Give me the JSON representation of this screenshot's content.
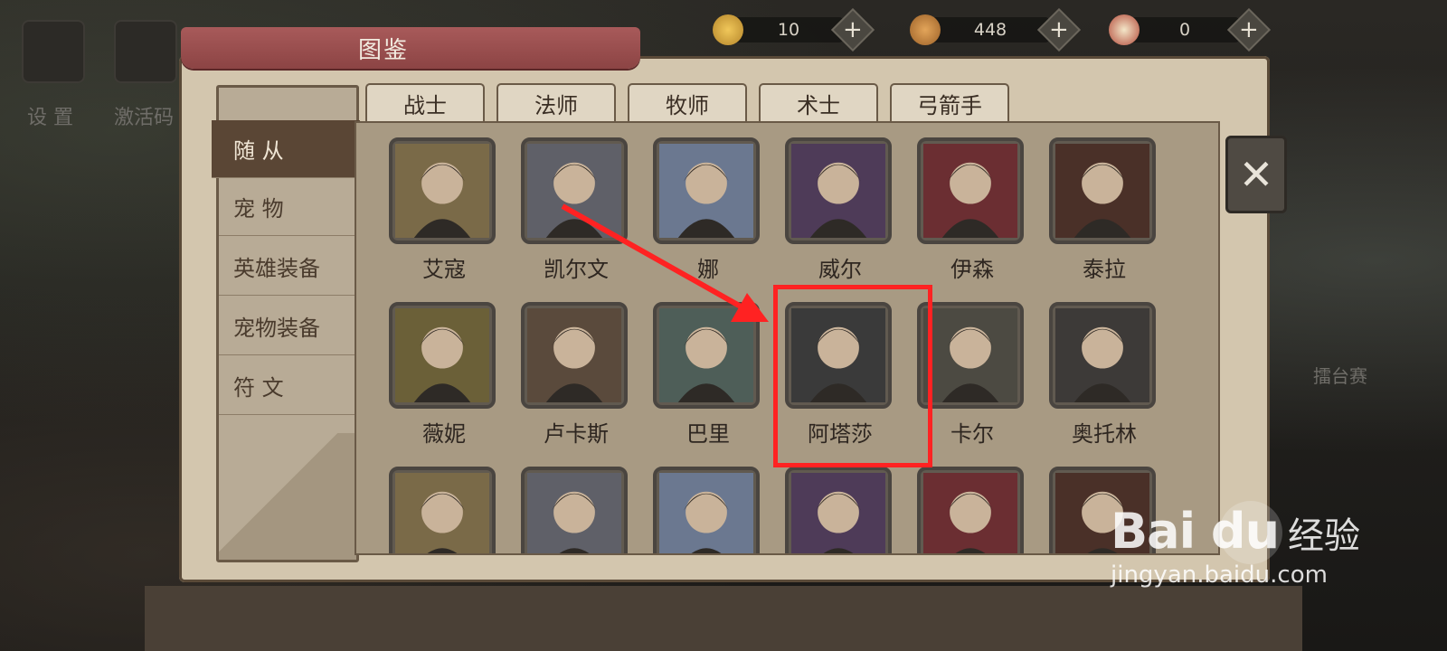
{
  "background": {
    "left_labels": [
      "设 置",
      "激活码"
    ],
    "right_label": "擂台赛"
  },
  "currencies": [
    {
      "icon": "gold-coin-icon",
      "value": "10"
    },
    {
      "icon": "coin-stack-icon",
      "value": "448"
    },
    {
      "icon": "scroll-icon",
      "value": "0"
    }
  ],
  "window": {
    "title": "图鉴"
  },
  "sidebar": {
    "items": [
      {
        "label": "随  从",
        "active": true
      },
      {
        "label": "宠  物",
        "active": false
      },
      {
        "label": "英雄装备",
        "active": false
      },
      {
        "label": "宠物装备",
        "active": false
      },
      {
        "label": "符  文",
        "active": false
      }
    ]
  },
  "tabs": [
    "战士",
    "法师",
    "牧师",
    "术士",
    "弓箭手"
  ],
  "heroes": {
    "row1": [
      "艾寇",
      "凯尔文",
      "娜",
      "威尔",
      "伊森",
      "泰拉"
    ],
    "row2": [
      "薇妮",
      "卢卡斯",
      "巴里",
      "阿塔莎",
      "卡尔",
      "奥托林"
    ],
    "row3_count_visible": 6
  },
  "highlighted_hero": "阿塔莎",
  "watermark": {
    "brand": "Bai du",
    "cn": "经验",
    "url": "jingyan.baidu.com"
  },
  "colors": {
    "highlight": "#ff2222",
    "ribbon": "#a85a5a",
    "panel": "#d3c6ae"
  }
}
